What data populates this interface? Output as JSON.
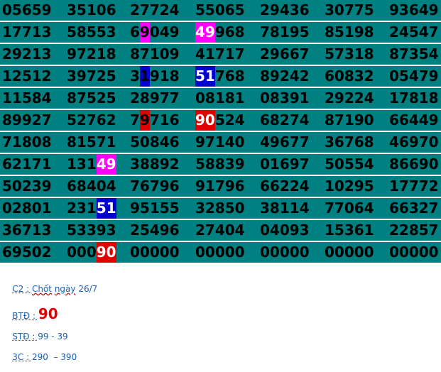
{
  "colors": {
    "row_background": "#008080",
    "row_separator": "#ffffff",
    "digit": "#000000",
    "highlight_text": "#ffffff",
    "magenta": "#ff00ff",
    "blue": "#0000d0",
    "red": "#e00000",
    "note_text": "#1a5fb4",
    "note_big": "#e00000"
  },
  "rows": [
    [
      "05659",
      "35106",
      "27724",
      "55065",
      "29436",
      "30775",
      "93649"
    ],
    [
      "17713",
      "58553",
      "69049",
      "49968",
      "78195",
      "85198",
      "24547"
    ],
    [
      "29213",
      "97218",
      "87109",
      "41717",
      "29667",
      "57318",
      "87354"
    ],
    [
      "12512",
      "39725",
      "31918",
      "51768",
      "89242",
      "60832",
      "05479"
    ],
    [
      "11584",
      "87525",
      "28977",
      "08181",
      "08391",
      "29224",
      "17818"
    ],
    [
      "89927",
      "52762",
      "79716",
      "90524",
      "68274",
      "87190",
      "66449"
    ],
    [
      "71808",
      "81571",
      "50846",
      "97140",
      "49677",
      "36768",
      "46970"
    ],
    [
      "62171",
      "13149",
      "38892",
      "58839",
      "01697",
      "50554",
      "86690"
    ],
    [
      "50239",
      "68404",
      "76796",
      "91796",
      "66224",
      "10295",
      "17772"
    ],
    [
      "02801",
      "23151",
      "95155",
      "32850",
      "38114",
      "77064",
      "66327"
    ],
    [
      "36713",
      "53393",
      "25496",
      "27404",
      "04093",
      "15361",
      "22857"
    ],
    [
      "69502",
      "00090",
      "00000",
      "00000",
      "00000",
      "00000",
      "00000"
    ]
  ],
  "highlights": [
    {
      "row": 1,
      "col": 2,
      "start": 1,
      "length": 1,
      "color": "magenta",
      "white_text": false
    },
    {
      "row": 1,
      "col": 3,
      "start": 0,
      "length": 2,
      "color": "magenta",
      "white_text": true
    },
    {
      "row": 3,
      "col": 2,
      "start": 1,
      "length": 1,
      "color": "blue",
      "white_text": false
    },
    {
      "row": 3,
      "col": 3,
      "start": 0,
      "length": 2,
      "color": "blue",
      "white_text": true
    },
    {
      "row": 5,
      "col": 2,
      "start": 1,
      "length": 1,
      "color": "red",
      "white_text": false
    },
    {
      "row": 5,
      "col": 3,
      "start": 0,
      "length": 2,
      "color": "red",
      "white_text": true
    },
    {
      "row": 7,
      "col": 1,
      "start": 3,
      "length": 2,
      "color": "magenta",
      "white_text": true
    },
    {
      "row": 9,
      "col": 1,
      "start": 3,
      "length": 2,
      "color": "blue",
      "white_text": true
    },
    {
      "row": 11,
      "col": 1,
      "start": 3,
      "length": 2,
      "color": "red",
      "white_text": true
    }
  ],
  "notes": {
    "c2_label": "C2 : ",
    "c2_word1": "Chốt",
    "c2_space": " ",
    "c2_word2": "ngày",
    "c2_rest": " 26/7",
    "btd_label": "BTĐ : ",
    "btd_value": "90",
    "std_label": "STĐ : ",
    "std_value": "99 - 39",
    "c3_label": "3C : ",
    "c3_value": "290  – 390"
  }
}
